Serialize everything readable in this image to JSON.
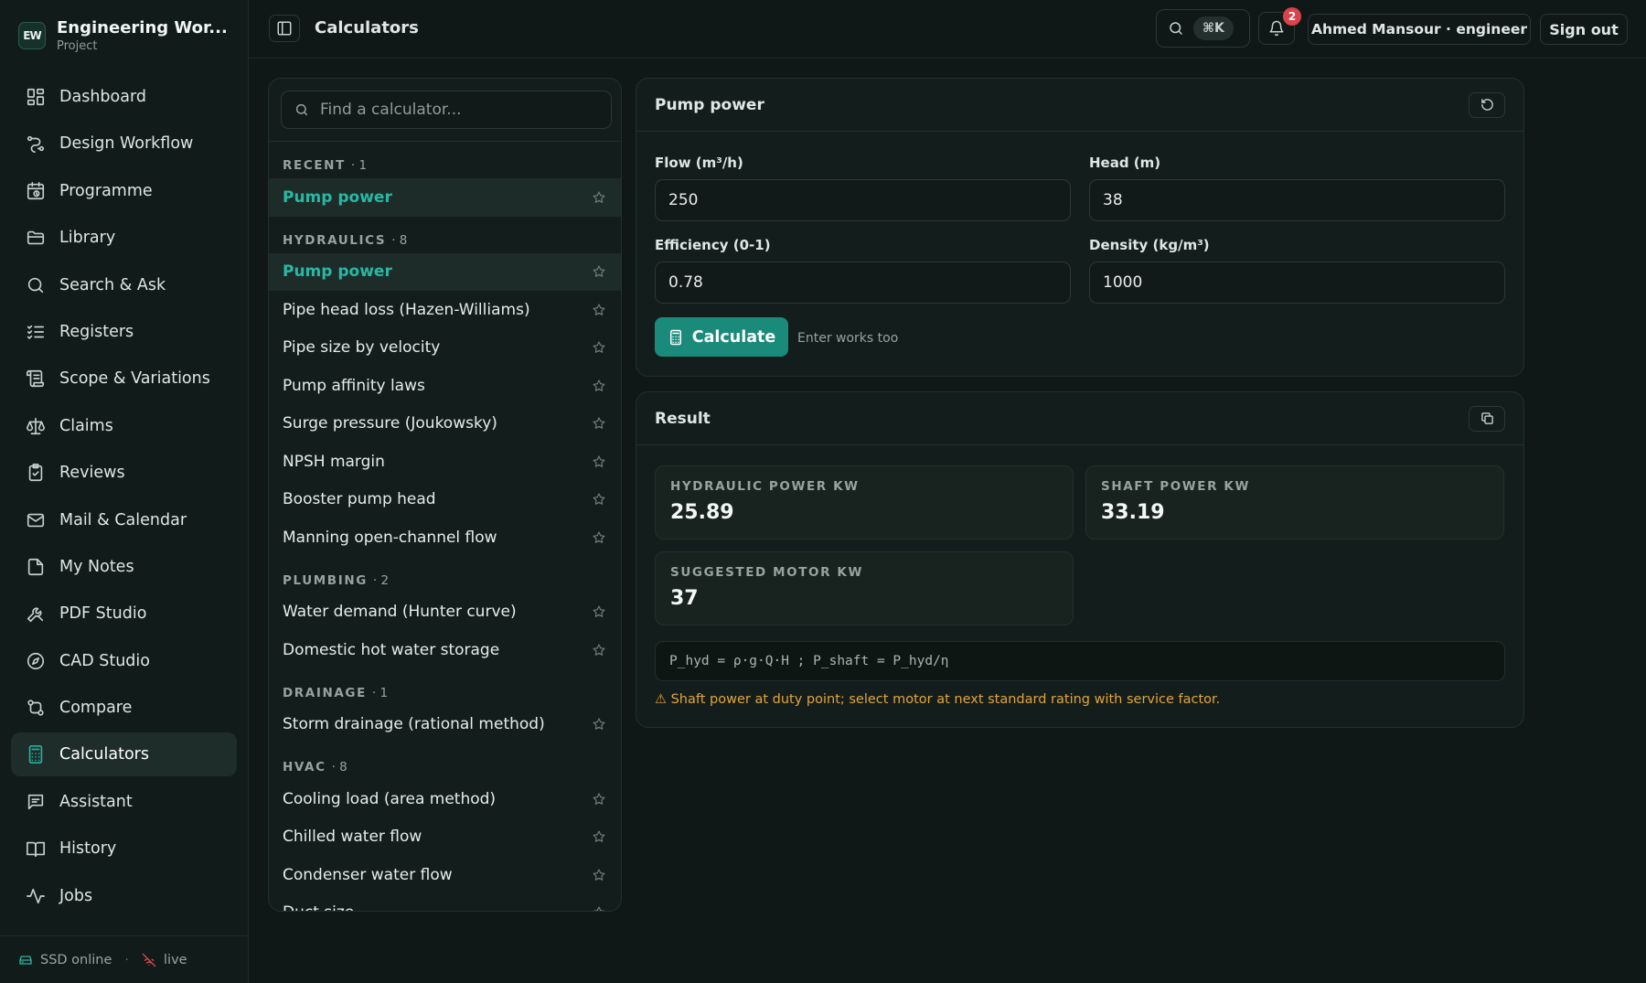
{
  "app": {
    "title": "Engineering Wor...",
    "subtitle": "Project",
    "logo_text": "EW"
  },
  "sidebar": {
    "items": [
      {
        "label": "Dashboard",
        "icon": "dashboard-icon"
      },
      {
        "label": "Design Workflow",
        "icon": "workflow-icon"
      },
      {
        "label": "Programme",
        "icon": "calendar-clock-icon"
      },
      {
        "label": "Library",
        "icon": "folder-icon"
      },
      {
        "label": "Search & Ask",
        "icon": "search-icon"
      },
      {
        "label": "Registers",
        "icon": "checklist-icon"
      },
      {
        "label": "Scope & Variations",
        "icon": "scroll-icon"
      },
      {
        "label": "Claims",
        "icon": "scale-icon"
      },
      {
        "label": "Reviews",
        "icon": "clipboard-check-icon"
      },
      {
        "label": "Mail & Calendar",
        "icon": "mail-icon"
      },
      {
        "label": "My Notes",
        "icon": "note-icon"
      },
      {
        "label": "PDF Studio",
        "icon": "tools-icon"
      },
      {
        "label": "CAD Studio",
        "icon": "compass-icon"
      },
      {
        "label": "Compare",
        "icon": "git-compare-icon"
      },
      {
        "label": "Calculators",
        "icon": "calculator-icon",
        "active": true
      },
      {
        "label": "Assistant",
        "icon": "chat-icon"
      },
      {
        "label": "History",
        "icon": "book-icon"
      },
      {
        "label": "Jobs",
        "icon": "activity-icon"
      }
    ],
    "footer": {
      "storage": "SSD online",
      "separator": "·",
      "live": "live"
    }
  },
  "topbar": {
    "page_title": "Calculators",
    "search_shortcut": "⌘K",
    "notifications_count": "2",
    "user": "Ahmed Mansour · engineer",
    "sign_out": "Sign out"
  },
  "calculator_list": {
    "search_placeholder": "Find a calculator...",
    "groups": [
      {
        "name": "RECENT",
        "count": "· 1",
        "items": [
          {
            "label": "Pump power",
            "active": true
          }
        ]
      },
      {
        "name": "HYDRAULICS",
        "count": "· 8",
        "items": [
          {
            "label": "Pump power",
            "active": true
          },
          {
            "label": "Pipe head loss (Hazen-Williams)"
          },
          {
            "label": "Pipe size by velocity"
          },
          {
            "label": "Pump affinity laws"
          },
          {
            "label": "Surge pressure (Joukowsky)"
          },
          {
            "label": "NPSH margin"
          },
          {
            "label": "Booster pump head"
          },
          {
            "label": "Manning open-channel flow"
          }
        ]
      },
      {
        "name": "PLUMBING",
        "count": "· 2",
        "items": [
          {
            "label": "Water demand (Hunter curve)"
          },
          {
            "label": "Domestic hot water storage"
          }
        ]
      },
      {
        "name": "DRAINAGE",
        "count": "· 1",
        "items": [
          {
            "label": "Storm drainage (rational method)"
          }
        ]
      },
      {
        "name": "HVAC",
        "count": "· 8",
        "items": [
          {
            "label": "Cooling load (area method)"
          },
          {
            "label": "Chilled water flow"
          },
          {
            "label": "Condenser water flow"
          },
          {
            "label": "Duct size"
          }
        ]
      }
    ]
  },
  "pump_form": {
    "title": "Pump power",
    "fields": {
      "flow": {
        "label": "Flow (m³/h)",
        "value": "250"
      },
      "head": {
        "label": "Head (m)",
        "value": "38"
      },
      "efficiency": {
        "label": "Efficiency (0-1)",
        "value": "0.78"
      },
      "density": {
        "label": "Density (kg/m³)",
        "value": "1000"
      }
    },
    "calculate_label": "Calculate",
    "hint": "Enter works too"
  },
  "result": {
    "title": "Result",
    "metrics": [
      {
        "label": "HYDRAULIC POWER KW",
        "value": "25.89"
      },
      {
        "label": "SHAFT POWER KW",
        "value": "33.19"
      },
      {
        "label": "SUGGESTED MOTOR KW",
        "value": "37"
      }
    ],
    "formula": "P_hyd = ρ·g·Q·H ; P_shaft = P_hyd/η",
    "warning": "⚠ Shaft power at duty point; select motor at next standard rating with service factor."
  },
  "colors": {
    "accent": "#1a8a7b",
    "accent_text": "#27b9a4",
    "warning": "#e3a33a",
    "badge": "#d9434b"
  }
}
